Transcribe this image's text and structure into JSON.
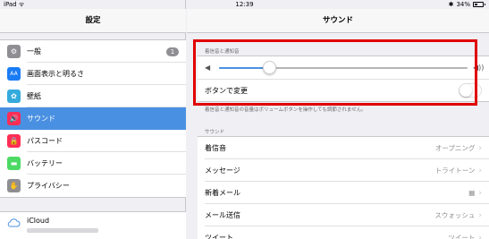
{
  "status_bar": {
    "device": "iPad",
    "time": "12:39",
    "battery": "34%"
  },
  "sidebar": {
    "title": "設定",
    "items": [
      {
        "label": "一般",
        "icon": "gear-icon",
        "color": "#8e8e93",
        "glyph": "⚙",
        "badge": "1"
      },
      {
        "label": "画面表示と明るさ",
        "icon": "display-icon",
        "color": "#1a7cf5",
        "glyph": "AA"
      },
      {
        "label": "壁紙",
        "icon": "wallpaper-icon",
        "color": "#35aadc",
        "glyph": "✿"
      },
      {
        "label": "サウンド",
        "icon": "speaker-icon",
        "color": "#ff2d55",
        "glyph": "🔊",
        "selected": true
      },
      {
        "label": "パスコード",
        "icon": "lock-icon",
        "color": "#ff2d55",
        "glyph": "🔒"
      },
      {
        "label": "バッテリー",
        "icon": "battery-icon",
        "color": "#4cd964",
        "glyph": "▬"
      },
      {
        "label": "プライバシー",
        "icon": "hand-icon",
        "color": "#8e8e93",
        "glyph": "✋"
      }
    ],
    "icloud": {
      "label": "iCloud",
      "icon": "cloud-icon"
    }
  },
  "main": {
    "title": "サウンド",
    "ringer_section": {
      "header": "着信音と通知音",
      "volume_level": 0.2,
      "change_with_buttons_label": "ボタンで変更",
      "change_with_buttons_on": false,
      "footer": "着信音と通知音の音量はボリュームボタンを操作しても調節されません。"
    },
    "sounds_section": {
      "header": "サウンド",
      "rows": [
        {
          "label": "着信音",
          "value": "オープニング"
        },
        {
          "label": "メッセージ",
          "value": "トライトーン"
        },
        {
          "label": "新着メール",
          "value": "▦"
        },
        {
          "label": "メール送信",
          "value": "スウォッシュ"
        },
        {
          "label": "ツイート",
          "value": "ツイート"
        }
      ]
    }
  },
  "highlight_color": "#e00000",
  "accent_color": "#4a90e2"
}
